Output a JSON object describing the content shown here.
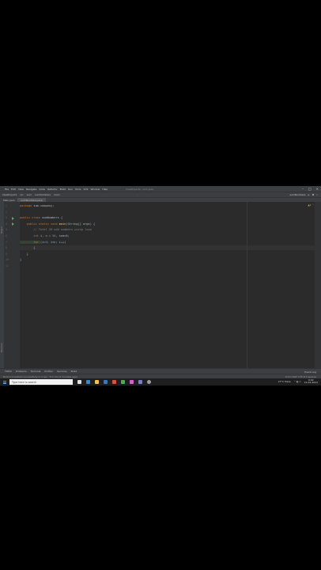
{
  "menu": {
    "items": [
      "File",
      "Edit",
      "View",
      "Navigate",
      "Code",
      "Refactor",
      "Build",
      "Run",
      "Tools",
      "VCS",
      "Window",
      "Help"
    ],
    "window_title": "IdeaProjects - sum.java"
  },
  "navbar": {
    "crumbs": [
      "IdeaProjects",
      "src",
      "sum",
      "sumNumbers",
      "main"
    ],
    "run_config": "sumNumbers"
  },
  "tabs": [
    {
      "label": "Main.java"
    },
    {
      "label": "sumNumbers.java"
    }
  ],
  "code": {
    "lines": [
      {
        "n": "1",
        "segments": [
          {
            "t": "package ",
            "c": "kw"
          },
          {
            "t": "sum.company;",
            "c": ""
          }
        ]
      },
      {
        "n": "2",
        "segments": []
      },
      {
        "n": "3",
        "segments": [
          {
            "t": "public class ",
            "c": "kw"
          },
          {
            "t": "sumNumbers {",
            "c": ""
          }
        ]
      },
      {
        "n": "4",
        "segments": [
          {
            "t": "    public static void ",
            "c": "kw"
          },
          {
            "t": "main",
            "c": "fn"
          },
          {
            "t": "(String[] args) {",
            "c": ""
          }
        ]
      },
      {
        "n": "5",
        "segments": [
          {
            "t": "        // Total 50 odd numbers using loop",
            "c": "cm"
          }
        ]
      },
      {
        "n": "6",
        "segments": [
          {
            "t": "        int ",
            "c": "kw"
          },
          {
            "t": "i, n = ",
            "c": ""
          },
          {
            "t": "50",
            "c": "num"
          },
          {
            "t": ", sum=0;",
            "c": ""
          }
        ]
      },
      {
        "n": "7",
        "segments": [
          {
            "t": "        for ",
            "c": "kw"
          },
          {
            "t": "(i=",
            "c": ""
          },
          {
            "t": "0",
            "c": "num"
          },
          {
            "t": "; i<n; i++)",
            "c": ""
          }
        ]
      },
      {
        "n": "8",
        "segments": [
          {
            "t": "        {",
            "c": ""
          }
        ]
      },
      {
        "n": "9",
        "segments": [
          {
            "t": "    }",
            "c": ""
          }
        ]
      },
      {
        "n": "10",
        "segments": [
          {
            "t": "}",
            "c": ""
          }
        ]
      },
      {
        "n": "11",
        "segments": []
      }
    ]
  },
  "left_strip": {
    "project_label": "Project",
    "structure_label": "Structure"
  },
  "bottom_tools": {
    "items": [
      "TODO",
      "Problems",
      "Terminal",
      "Profiler",
      "Services",
      "Build"
    ],
    "right": "Event Log"
  },
  "status": {
    "left": "Build completed successfully in 2 sec, 713 ms (2 minutes ago)",
    "right": "8:10  CRLF  UTF-8  4 spaces"
  },
  "taskbar": {
    "search_placeholder": "Type here to search",
    "weather": "27°C Haze",
    "time": "9:02",
    "date": "12-04-2022"
  },
  "colors": {
    "editor_bg": "#2b2b2b",
    "keyword": "#cc7832",
    "comment": "#808080",
    "number": "#6897bb",
    "function": "#ffc66d"
  }
}
